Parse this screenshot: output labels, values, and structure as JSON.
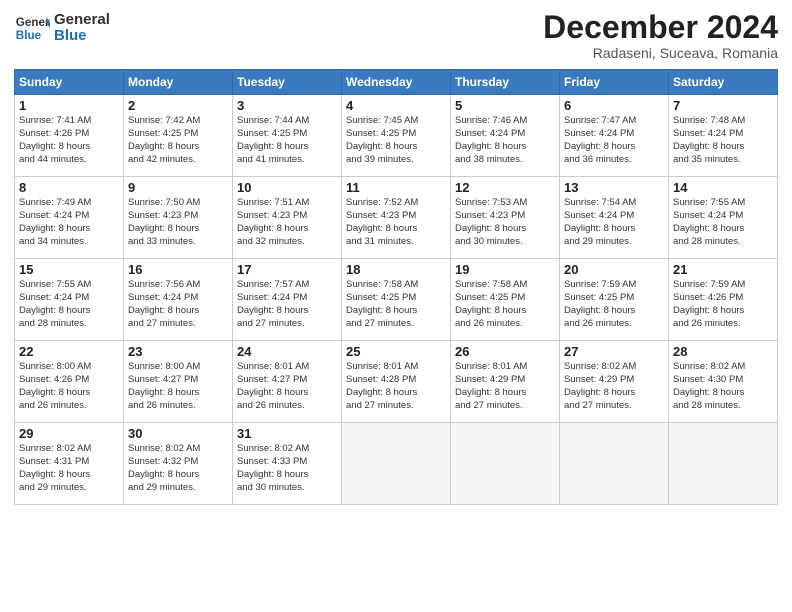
{
  "header": {
    "logo_general": "General",
    "logo_blue": "Blue",
    "month_title": "December 2024",
    "location": "Radaseni, Suceava, Romania"
  },
  "days_of_week": [
    "Sunday",
    "Monday",
    "Tuesday",
    "Wednesday",
    "Thursday",
    "Friday",
    "Saturday"
  ],
  "weeks": [
    [
      {
        "day": "1",
        "info": "Sunrise: 7:41 AM\nSunset: 4:26 PM\nDaylight: 8 hours\nand 44 minutes."
      },
      {
        "day": "2",
        "info": "Sunrise: 7:42 AM\nSunset: 4:25 PM\nDaylight: 8 hours\nand 42 minutes."
      },
      {
        "day": "3",
        "info": "Sunrise: 7:44 AM\nSunset: 4:25 PM\nDaylight: 8 hours\nand 41 minutes."
      },
      {
        "day": "4",
        "info": "Sunrise: 7:45 AM\nSunset: 4:25 PM\nDaylight: 8 hours\nand 39 minutes."
      },
      {
        "day": "5",
        "info": "Sunrise: 7:46 AM\nSunset: 4:24 PM\nDaylight: 8 hours\nand 38 minutes."
      },
      {
        "day": "6",
        "info": "Sunrise: 7:47 AM\nSunset: 4:24 PM\nDaylight: 8 hours\nand 36 minutes."
      },
      {
        "day": "7",
        "info": "Sunrise: 7:48 AM\nSunset: 4:24 PM\nDaylight: 8 hours\nand 35 minutes."
      }
    ],
    [
      {
        "day": "8",
        "info": "Sunrise: 7:49 AM\nSunset: 4:24 PM\nDaylight: 8 hours\nand 34 minutes."
      },
      {
        "day": "9",
        "info": "Sunrise: 7:50 AM\nSunset: 4:23 PM\nDaylight: 8 hours\nand 33 minutes."
      },
      {
        "day": "10",
        "info": "Sunrise: 7:51 AM\nSunset: 4:23 PM\nDaylight: 8 hours\nand 32 minutes."
      },
      {
        "day": "11",
        "info": "Sunrise: 7:52 AM\nSunset: 4:23 PM\nDaylight: 8 hours\nand 31 minutes."
      },
      {
        "day": "12",
        "info": "Sunrise: 7:53 AM\nSunset: 4:23 PM\nDaylight: 8 hours\nand 30 minutes."
      },
      {
        "day": "13",
        "info": "Sunrise: 7:54 AM\nSunset: 4:24 PM\nDaylight: 8 hours\nand 29 minutes."
      },
      {
        "day": "14",
        "info": "Sunrise: 7:55 AM\nSunset: 4:24 PM\nDaylight: 8 hours\nand 28 minutes."
      }
    ],
    [
      {
        "day": "15",
        "info": "Sunrise: 7:55 AM\nSunset: 4:24 PM\nDaylight: 8 hours\nand 28 minutes."
      },
      {
        "day": "16",
        "info": "Sunrise: 7:56 AM\nSunset: 4:24 PM\nDaylight: 8 hours\nand 27 minutes."
      },
      {
        "day": "17",
        "info": "Sunrise: 7:57 AM\nSunset: 4:24 PM\nDaylight: 8 hours\nand 27 minutes."
      },
      {
        "day": "18",
        "info": "Sunrise: 7:58 AM\nSunset: 4:25 PM\nDaylight: 8 hours\nand 27 minutes."
      },
      {
        "day": "19",
        "info": "Sunrise: 7:58 AM\nSunset: 4:25 PM\nDaylight: 8 hours\nand 26 minutes."
      },
      {
        "day": "20",
        "info": "Sunrise: 7:59 AM\nSunset: 4:25 PM\nDaylight: 8 hours\nand 26 minutes."
      },
      {
        "day": "21",
        "info": "Sunrise: 7:59 AM\nSunset: 4:26 PM\nDaylight: 8 hours\nand 26 minutes."
      }
    ],
    [
      {
        "day": "22",
        "info": "Sunrise: 8:00 AM\nSunset: 4:26 PM\nDaylight: 8 hours\nand 26 minutes."
      },
      {
        "day": "23",
        "info": "Sunrise: 8:00 AM\nSunset: 4:27 PM\nDaylight: 8 hours\nand 26 minutes."
      },
      {
        "day": "24",
        "info": "Sunrise: 8:01 AM\nSunset: 4:27 PM\nDaylight: 8 hours\nand 26 minutes."
      },
      {
        "day": "25",
        "info": "Sunrise: 8:01 AM\nSunset: 4:28 PM\nDaylight: 8 hours\nand 27 minutes."
      },
      {
        "day": "26",
        "info": "Sunrise: 8:01 AM\nSunset: 4:29 PM\nDaylight: 8 hours\nand 27 minutes."
      },
      {
        "day": "27",
        "info": "Sunrise: 8:02 AM\nSunset: 4:29 PM\nDaylight: 8 hours\nand 27 minutes."
      },
      {
        "day": "28",
        "info": "Sunrise: 8:02 AM\nSunset: 4:30 PM\nDaylight: 8 hours\nand 28 minutes."
      }
    ],
    [
      {
        "day": "29",
        "info": "Sunrise: 8:02 AM\nSunset: 4:31 PM\nDaylight: 8 hours\nand 29 minutes."
      },
      {
        "day": "30",
        "info": "Sunrise: 8:02 AM\nSunset: 4:32 PM\nDaylight: 8 hours\nand 29 minutes."
      },
      {
        "day": "31",
        "info": "Sunrise: 8:02 AM\nSunset: 4:33 PM\nDaylight: 8 hours\nand 30 minutes."
      },
      {
        "day": "",
        "info": ""
      },
      {
        "day": "",
        "info": ""
      },
      {
        "day": "",
        "info": ""
      },
      {
        "day": "",
        "info": ""
      }
    ]
  ]
}
